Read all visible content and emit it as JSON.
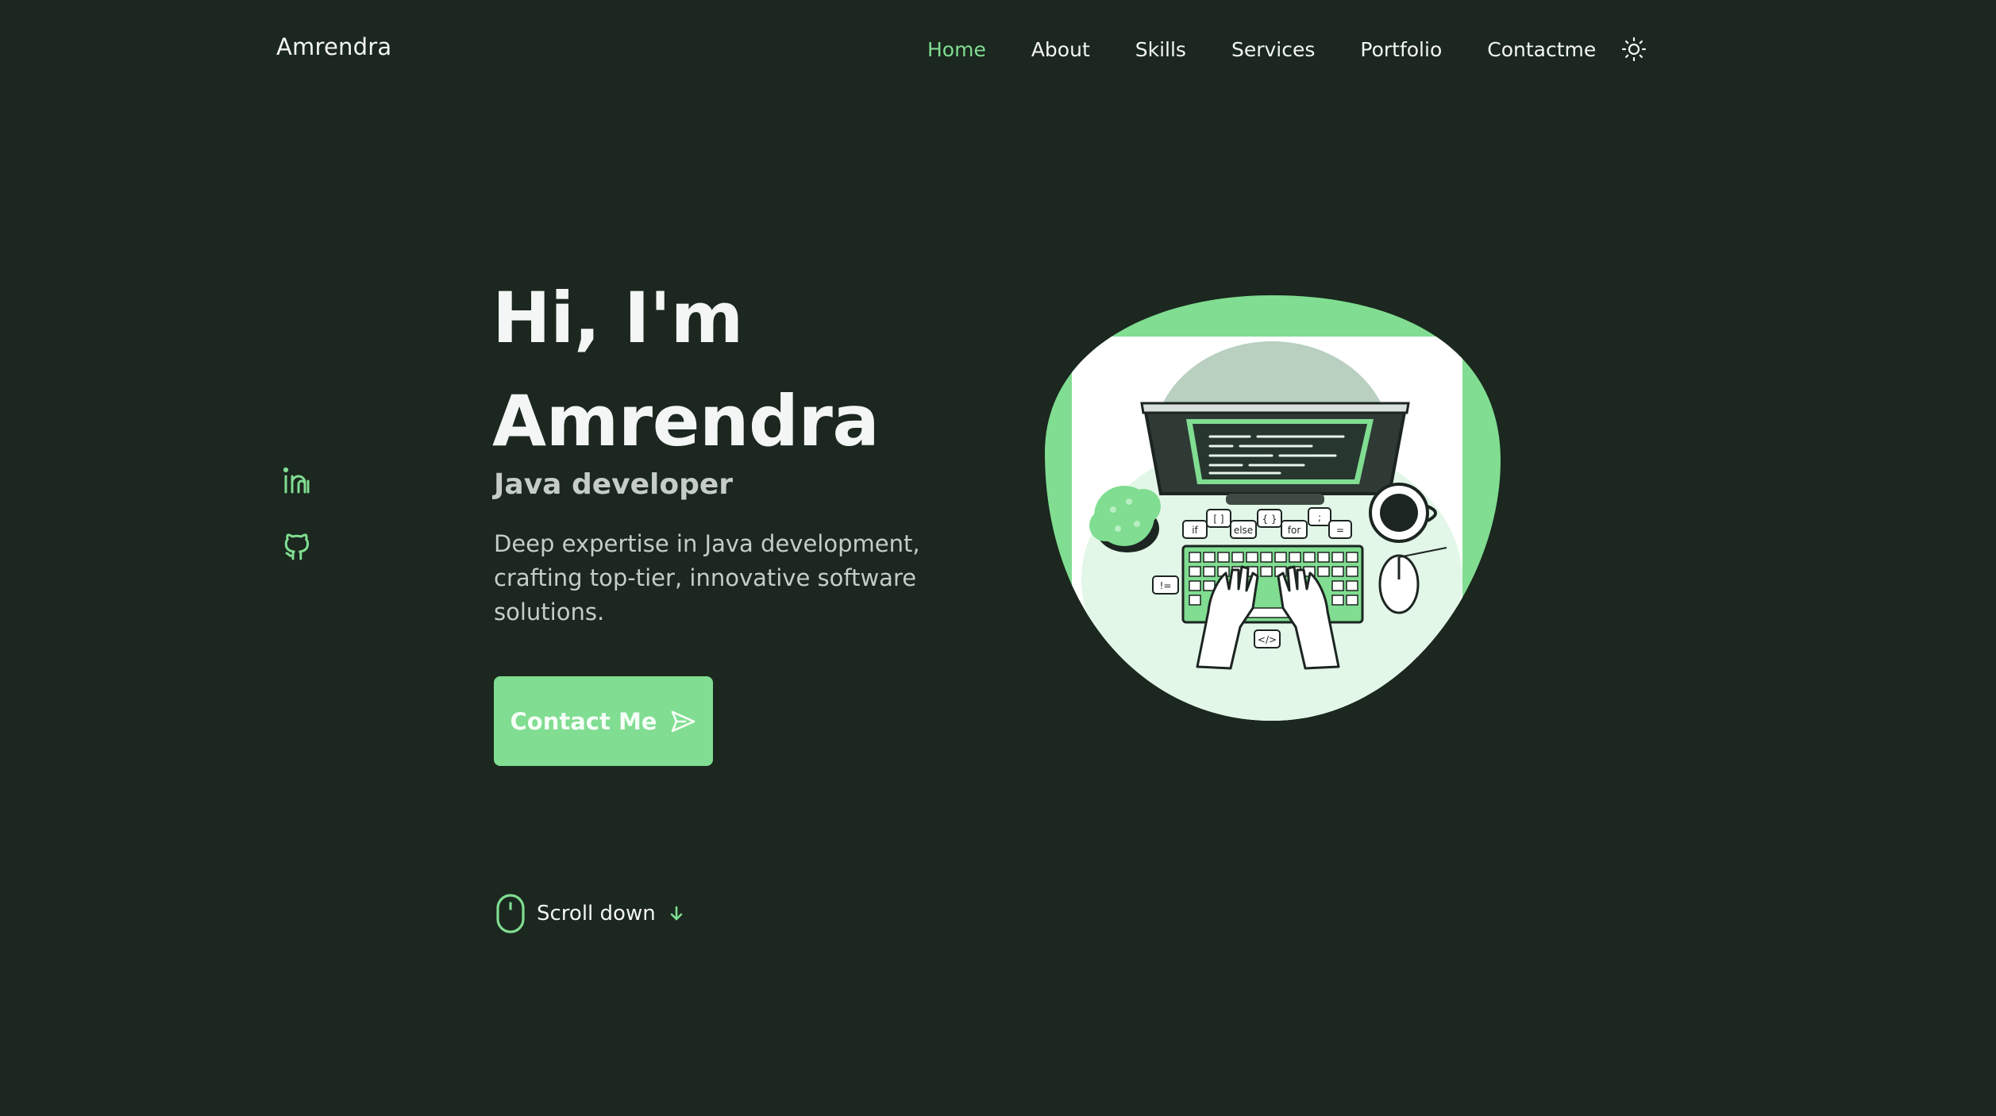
{
  "header": {
    "logo": "Amrendra",
    "nav": [
      {
        "label": "Home",
        "active": true
      },
      {
        "label": "About",
        "active": false
      },
      {
        "label": "Skills",
        "active": false
      },
      {
        "label": "Services",
        "active": false
      },
      {
        "label": "Portfolio",
        "active": false
      },
      {
        "label": "Contactme",
        "active": false
      }
    ],
    "theme_icon": "sun-icon"
  },
  "social": [
    {
      "icon": "linkedin-icon"
    },
    {
      "icon": "github-icon"
    }
  ],
  "hero": {
    "title_line1": "Hi, I'm",
    "title_line2": "Amrendra",
    "subtitle": "Java developer",
    "description": "Deep expertise in Java development, crafting top-tier, innovative software solutions.",
    "cta_label": "Contact Me",
    "cta_icon": "send-icon",
    "illustration_tags": [
      "if",
      "[ ]",
      "else",
      "{ }",
      "for",
      ";",
      "=",
      "!=",
      "</>"
    ]
  },
  "scroll": {
    "label": "Scroll down",
    "icon": "mouse-icon",
    "arrow_icon": "arrow-down-icon"
  },
  "colors": {
    "background": "#1b271f",
    "accent": "#80dd91",
    "text": "#f3f6f4",
    "muted_text": "#c6ccc8"
  }
}
